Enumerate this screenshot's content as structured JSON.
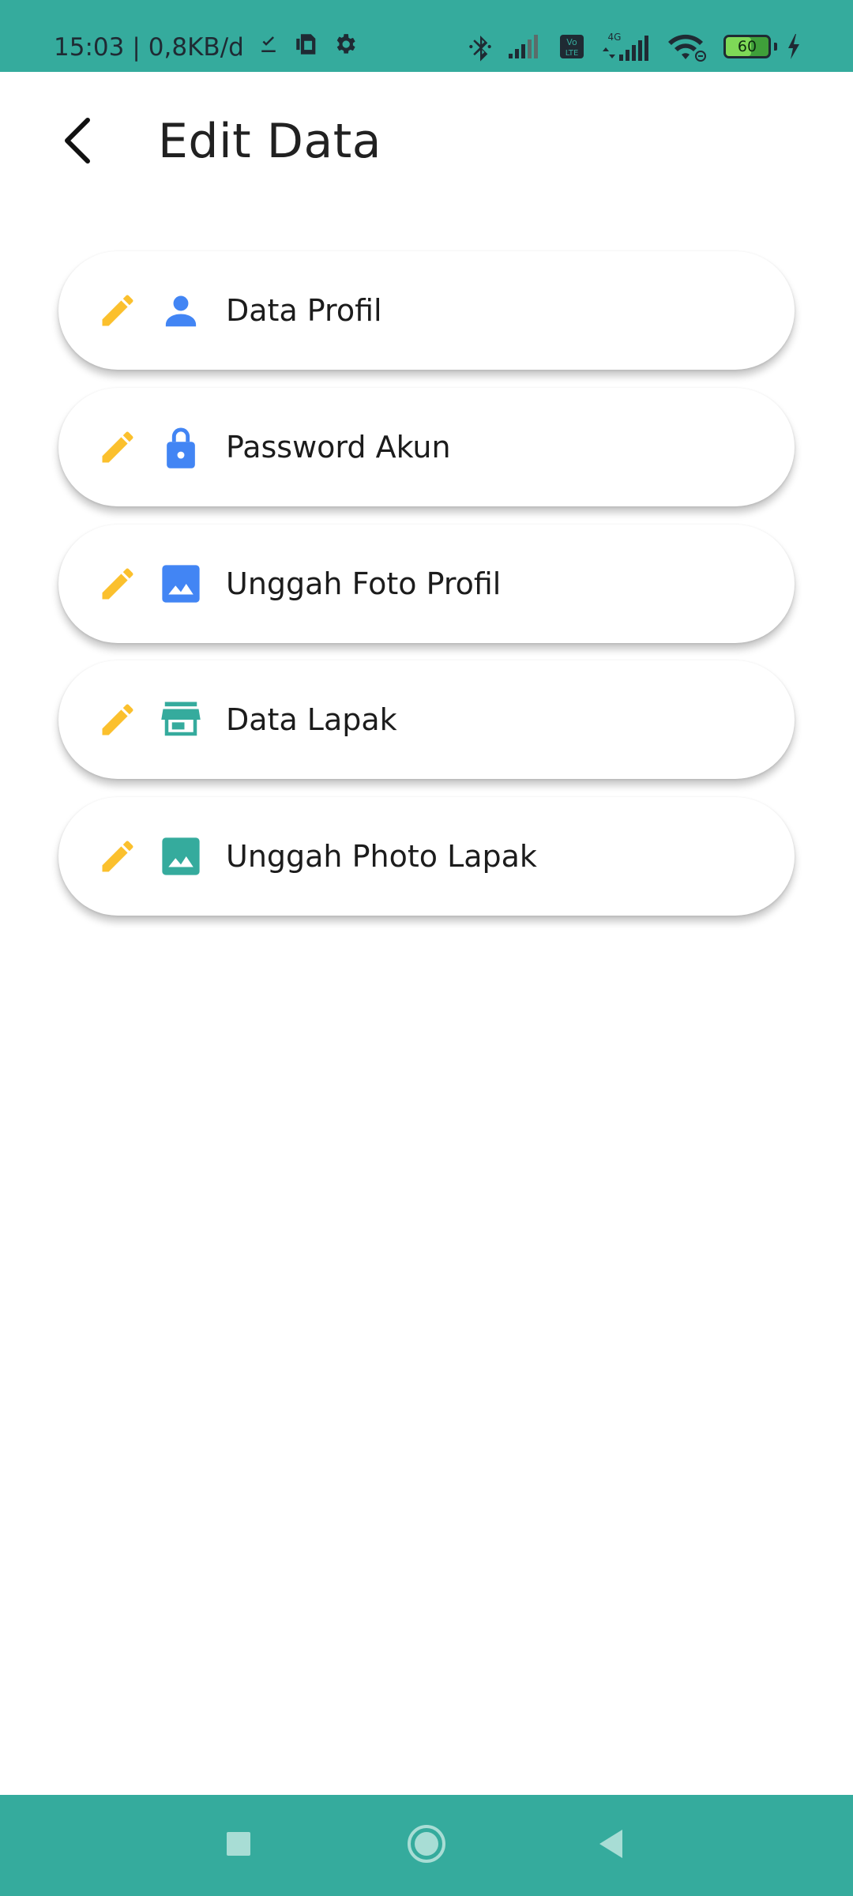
{
  "status_bar": {
    "time": "15:03",
    "separator": "|",
    "net_speed": "0,8KB/d",
    "battery_level": "60",
    "lte_label_top": "Vo",
    "lte_label_bottom": "LTE",
    "network_type": "4G",
    "colors": {
      "background": "#35ab9d",
      "icon": "#1f2a33",
      "battery_fill": "#7ed957"
    },
    "icons": [
      "download-done-icon",
      "sim-card-icon",
      "settings-gear-icon",
      "bluetooth-icon",
      "signal-icon",
      "volte-icon",
      "4g-signal-icon",
      "wifi-icon",
      "battery-icon",
      "charging-icon"
    ]
  },
  "header": {
    "title": "Edit Data",
    "back_icon": "arrow-back-icon"
  },
  "menu": {
    "items": [
      {
        "label": "Data Profil",
        "edit_icon": "pencil-icon",
        "icon": "person-icon",
        "icon_color": "#4285f4"
      },
      {
        "label": "Password Akun",
        "edit_icon": "pencil-icon",
        "icon": "lock-icon",
        "icon_color": "#4285f4"
      },
      {
        "label": "Unggah Foto Profil",
        "edit_icon": "pencil-icon",
        "icon": "image-icon",
        "icon_color": "#4285f4"
      },
      {
        "label": "Data Lapak",
        "edit_icon": "pencil-icon",
        "icon": "store-icon",
        "icon_color": "#35ab9d"
      },
      {
        "label": "Unggah Photo Lapak",
        "edit_icon": "pencil-icon",
        "icon": "image-icon",
        "icon_color": "#35ab9d"
      }
    ],
    "edit_icon_color": "#fbc02d"
  },
  "nav_bar": {
    "background": "#35ab9d",
    "buttons": [
      "recents-square-icon",
      "home-circle-icon",
      "back-triangle-icon"
    ]
  }
}
